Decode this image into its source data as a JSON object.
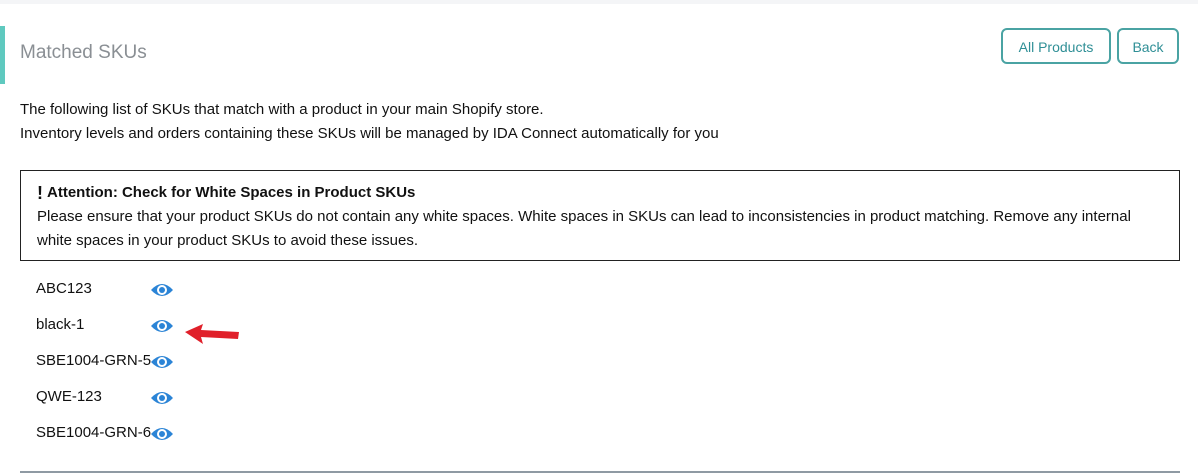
{
  "page": {
    "title": "Matched SKUs",
    "buttons": {
      "all_products": "All Products",
      "back": "Back"
    }
  },
  "intro": {
    "line1": "The following list of SKUs that match with a product in your main Shopify store.",
    "line2": "Inventory levels and orders containing these SKUs will be managed by IDA Connect automatically for you"
  },
  "attention": {
    "icon": "!",
    "title": "Attention: Check for White Spaces in Product SKUs",
    "body": "Please ensure that your product SKUs do not contain any white spaces. White spaces in SKUs can lead to inconsistencies in product matching. Remove any internal white spaces in your product SKUs to avoid these issues."
  },
  "skus": [
    {
      "label": "ABC123",
      "icon": "eye-icon"
    },
    {
      "label": "black-1",
      "icon": "eye-icon"
    },
    {
      "label": "SBE1004-GRN-5",
      "icon": "eye-icon"
    },
    {
      "label": "QWE-123",
      "icon": "eye-icon"
    },
    {
      "label": "SBE1004-GRN-6",
      "icon": "eye-icon"
    }
  ],
  "colors": {
    "accent": "#5fc9bf",
    "button_border": "#4aa3a3",
    "button_text": "#2f8f96",
    "eye_icon": "#2b84d6",
    "annotation_arrow": "#e0202a"
  }
}
